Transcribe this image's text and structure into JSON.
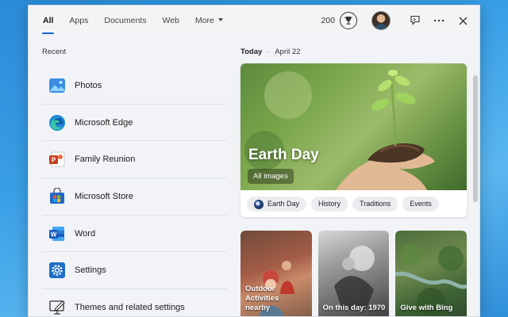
{
  "tabs": [
    {
      "label": "All",
      "active": true
    },
    {
      "label": "Apps"
    },
    {
      "label": "Documents"
    },
    {
      "label": "Web"
    },
    {
      "label": "More"
    }
  ],
  "header": {
    "points": "200",
    "icons": [
      "trophy-icon",
      "avatar",
      "feedback-icon",
      "more-icon",
      "close-icon"
    ]
  },
  "recent": {
    "label": "Recent",
    "items": [
      {
        "label": "Photos",
        "icon": "photos-icon"
      },
      {
        "label": "Microsoft Edge",
        "icon": "edge-icon"
      },
      {
        "label": "Family Reunion",
        "icon": "powerpoint-icon"
      },
      {
        "label": "Microsoft Store",
        "icon": "store-icon"
      },
      {
        "label": "Word",
        "icon": "word-icon"
      },
      {
        "label": "Settings",
        "icon": "settings-icon"
      },
      {
        "label": "Themes and related settings",
        "icon": "themes-icon"
      }
    ]
  },
  "today": {
    "label": "Today",
    "date": "April 22",
    "separator": "·"
  },
  "hero": {
    "title": "Earth Day",
    "sub": "All images",
    "chips": [
      "Earth Day",
      "History",
      "Traditions",
      "Events"
    ]
  },
  "cards": [
    {
      "label": "Outdoor Activities nearby"
    },
    {
      "label": "On this day: 1970"
    },
    {
      "label": "Give with Bing"
    }
  ],
  "colors": {
    "accent": "#0a63c9",
    "panel": "#f1f3f6"
  }
}
